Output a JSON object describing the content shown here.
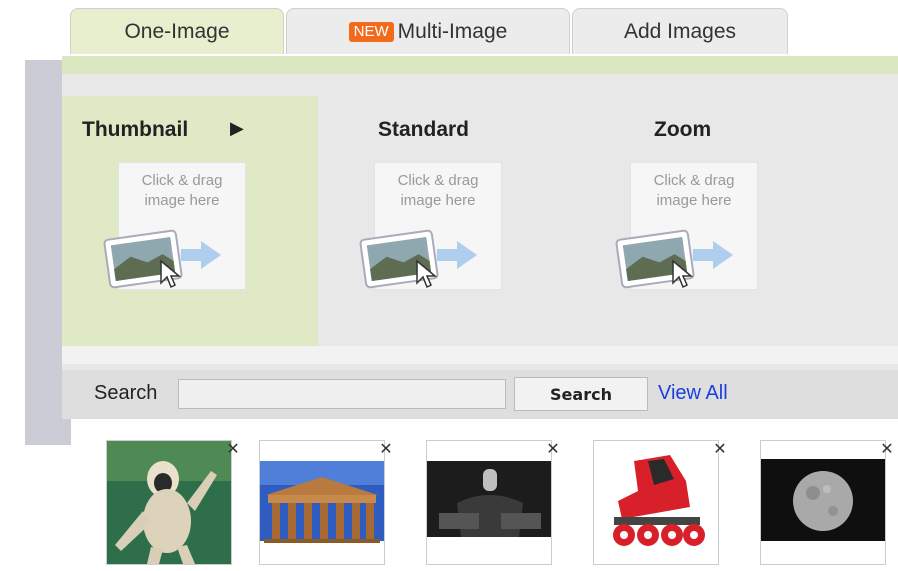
{
  "tabs": [
    {
      "label": "One-Image",
      "active": true
    },
    {
      "badge": "NEW",
      "label": "Multi-Image",
      "active": false
    },
    {
      "label": "Add Images",
      "active": false
    }
  ],
  "slots": [
    {
      "label": "Thumbnail",
      "arrow": "▶",
      "drop_text": "Click & drag\nimage here",
      "active": true
    },
    {
      "label": "Standard",
      "drop_text": "Click & drag\nimage here",
      "active": false
    },
    {
      "label": "Zoom",
      "drop_text": "Click & drag\nimage here",
      "active": false
    }
  ],
  "search": {
    "label": "Search",
    "input_value": "",
    "button_label": "Search",
    "view_all": "View All"
  },
  "thumbnails": [
    {
      "name": "gibbon-thumb",
      "close": "✕"
    },
    {
      "name": "greek-temple-thumb",
      "close": "✕"
    },
    {
      "name": "car-gear-shift-thumb",
      "close": "✕"
    },
    {
      "name": "inline-skate-thumb",
      "close": "✕"
    },
    {
      "name": "moon-thumb",
      "close": "✕"
    }
  ],
  "colors": {
    "active_tab": "#e7efcf",
    "link": "#1b3fe0",
    "badge": "#f26b1d",
    "watermark": "#7878aa"
  }
}
